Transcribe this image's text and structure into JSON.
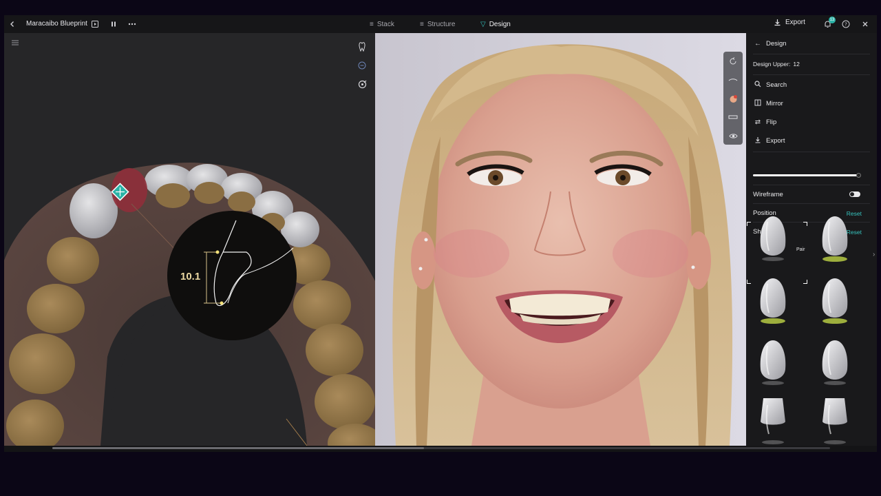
{
  "app": {
    "title": "Maracaibo Blueprint",
    "back_icon": "chevron-left-icon",
    "play_icon": "play-icon",
    "pause_icon": "pause-icon",
    "more_icon": "more-icon"
  },
  "tabs": [
    {
      "label": "Stack",
      "icon": "stack-icon",
      "active": false
    },
    {
      "label": "Structure",
      "icon": "structure-icon",
      "active": false
    },
    {
      "label": "Design",
      "icon": "design-icon",
      "active": true
    }
  ],
  "topbar_right": {
    "export_label": "Export",
    "notification_count": "13",
    "icons": [
      "download-icon",
      "bell-icon",
      "help-icon",
      "close-icon"
    ]
  },
  "viewport": {
    "menu_icon": "menu-icon",
    "tools": [
      "tooth-icon",
      "minus-circle-icon",
      "target-icon"
    ],
    "measurement": "10.1"
  },
  "photo_toolbar": {
    "tools": [
      "rotate-icon",
      "smile-curve-icon",
      "shade-icon",
      "ruler-icon",
      "eye-icon"
    ]
  },
  "panel": {
    "header": "Design",
    "design_upper_label": "Design Upper:",
    "design_upper_value": "12",
    "actions": [
      {
        "label": "Search",
        "icon": "search-icon"
      },
      {
        "label": "Mirror",
        "icon": "mirror-icon"
      },
      {
        "label": "Flip",
        "icon": "flip-icon"
      },
      {
        "label": "Export",
        "icon": "download-icon"
      }
    ],
    "slider_value": 0.95,
    "wireframe_label": "Wireframe",
    "wireframe_on": true,
    "position_label": "Position",
    "position_reset": "Reset",
    "shape_label": "Shape",
    "shape_reset": "Reset",
    "pair_label": "Pair",
    "shapes_count_visible": 8,
    "colors": {
      "accent": "#36c2bd",
      "badge": "#2bb3a7",
      "highlight": "#c9e04a"
    }
  }
}
